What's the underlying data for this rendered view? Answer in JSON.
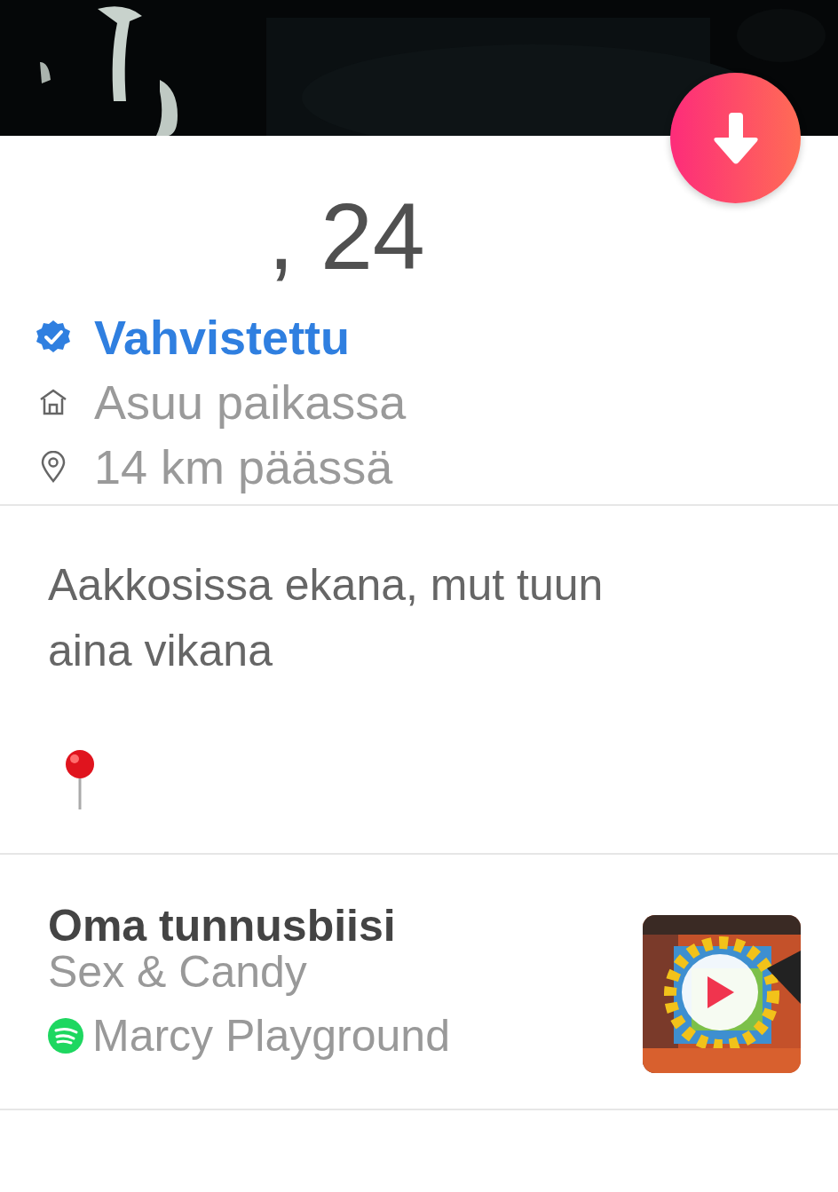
{
  "profile": {
    "name_age": ", 24",
    "verified": {
      "label": "Vahvistettu"
    },
    "details": [
      {
        "kind": "home",
        "text": "Asuu paikassa"
      },
      {
        "kind": "location",
        "text": "14 km päässä"
      }
    ]
  },
  "bio": {
    "text": "Aakkosissa ekana, mut tuun aina vikana"
  },
  "anthem": {
    "title": "Oma tunnusbiisi",
    "song": "Sex & Candy",
    "artist": "Marcy Playground"
  }
}
